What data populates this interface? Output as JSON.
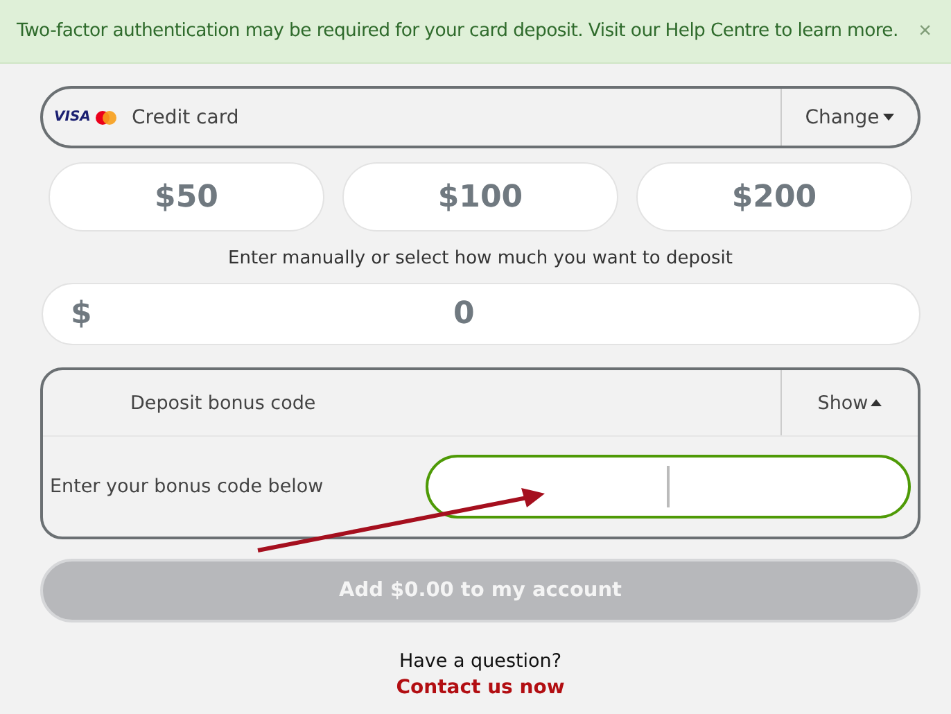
{
  "banner": {
    "message": "Two-factor authentication may be required for your card deposit. Visit our Help Centre to learn more.",
    "close": "×"
  },
  "payment_method": {
    "brand": "VISA",
    "label": "Credit card",
    "action": "Change",
    "expanded": false
  },
  "amount_options": [
    {
      "label": "$50",
      "selected": false
    },
    {
      "label": "$100",
      "selected": false
    },
    {
      "label": "$200",
      "selected": false
    }
  ],
  "hint": "Enter manually or select how much you want to deposit",
  "amount_field": {
    "currency": "$",
    "value": "0"
  },
  "bonus": {
    "title": "Deposit bonus code",
    "toggle": "Show",
    "expanded": true,
    "prompt": "Enter your bonus code below",
    "focused": true
  },
  "submit": {
    "label": "Add $0.00 to my account",
    "disabled": true
  },
  "help": {
    "question": "Have a question?",
    "link": "Contact us now"
  }
}
